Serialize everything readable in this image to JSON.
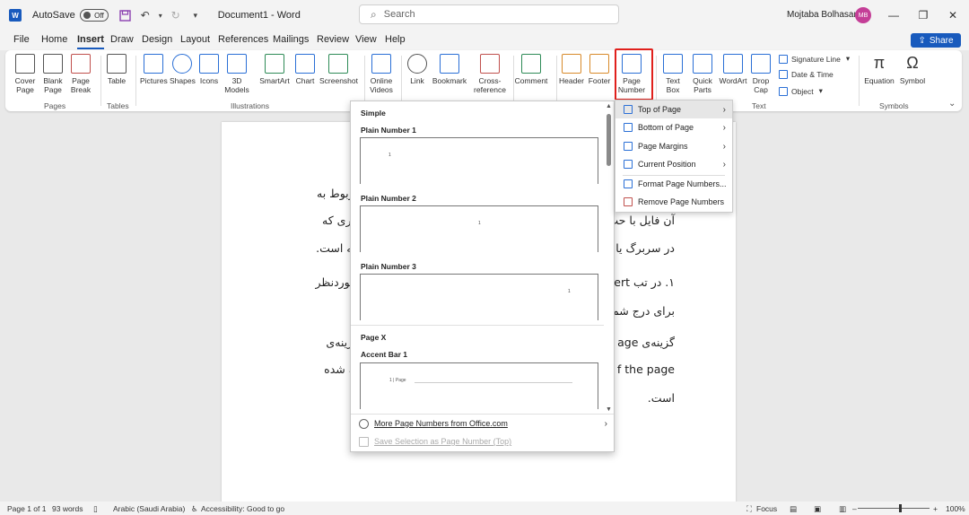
{
  "titlebar": {
    "app_icon_letter": "W",
    "autosave_label": "AutoSave",
    "autosave_state": "Off",
    "document_title": "Document1 - Word",
    "search_placeholder": "Search",
    "user_name": "Mojtaba Bolhasani",
    "user_initials": "MB",
    "qa_customize": "▾"
  },
  "tabs": [
    "File",
    "Home",
    "Insert",
    "Draw",
    "Design",
    "Layout",
    "References",
    "Mailings",
    "Review",
    "View",
    "Help"
  ],
  "active_tab": "Insert",
  "share_label": "Share",
  "ribbon": {
    "pages": {
      "cover": "Cover\nPage",
      "blank": "Blank\nPage",
      "break": "Page\nBreak",
      "group": "Pages"
    },
    "tables": {
      "table": "Table",
      "group": "Tables"
    },
    "illustrations": {
      "pictures": "Pictures",
      "shapes": "Shapes",
      "icons": "Icons",
      "models": "3D\nModels",
      "smartart": "SmartArt",
      "chart": "Chart",
      "screenshot": "Screenshot",
      "group": "Illustrations"
    },
    "media": {
      "online_videos": "Online\nVideos"
    },
    "links": {
      "link": "Link",
      "bookmark": "Bookmark",
      "crossref": "Cross-\nreference"
    },
    "comments": {
      "comment": "Comment"
    },
    "header_footer": {
      "header": "Header",
      "footer": "Footer",
      "page_number": "Page\nNumber"
    },
    "text": {
      "textbox": "Text\nBox",
      "quickparts": "Quick\nParts",
      "wordart": "WordArt",
      "dropcap": "Drop\nCap",
      "signature": "Signature Line",
      "datetime": "Date & Time",
      "object": "Object",
      "group": "Text"
    },
    "symbols": {
      "equation": "Equation",
      "symbol": "Symbol",
      "group": "Symbols"
    }
  },
  "document": {
    "lines": [
      "ت مربوط به",
      "آن فایل با حت",
      "عناصری که",
      "در سربرگ یا",
      "صفحه است.",
      "۱. در تب ert",
      "حل موردنظر",
      "برای درج شم",
      "گزینه‌ی age",
      "ند. گزینه‌ی",
      "f the page",
      "گرفته شده",
      "است."
    ]
  },
  "page_number_menu": {
    "items": [
      {
        "label": "Top of Page",
        "submenu": true
      },
      {
        "label": "Bottom of Page",
        "submenu": true
      },
      {
        "label": "Page Margins",
        "submenu": true
      },
      {
        "label": "Current Position",
        "submenu": true
      },
      {
        "label": "Format Page Numbers...",
        "submenu": false
      },
      {
        "label": "Remove Page Numbers",
        "submenu": false
      }
    ]
  },
  "gallery": {
    "section_simple": "Simple",
    "plain1": "Plain Number 1",
    "plain2": "Plain Number 2",
    "plain3": "Plain Number 3",
    "section_pagex": "Page X",
    "accent1": "Accent Bar 1",
    "thumb_number": "1",
    "accent_text": "1 | Page",
    "more_label": "More Page Numbers from Office.com",
    "save_label": "Save Selection as Page Number (Top)"
  },
  "statusbar": {
    "page": "Page 1 of 1",
    "words": "93 words",
    "language": "Arabic (Saudi Arabia)",
    "accessibility": "Accessibility: Good to go",
    "focus": "Focus",
    "zoom": "100%"
  },
  "colors": {
    "word_blue": "#185abd",
    "highlight_red": "#e0201c",
    "avatar": "#c43e97"
  }
}
